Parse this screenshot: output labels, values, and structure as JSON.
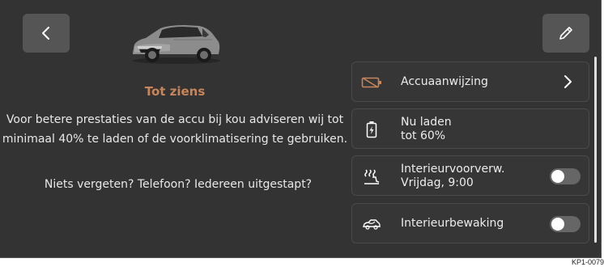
{
  "colors": {
    "screen_bg": "#333333",
    "accent": "#c7855a",
    "text": "#ececec",
    "tile_bg": "#363636",
    "button_bg": "#555555"
  },
  "header": {
    "back_icon": "chevron-left-icon",
    "edit_icon": "pencil-icon"
  },
  "message": {
    "title": "Tot ziens",
    "body": "Voor betere prestaties van de accu bij kou adviseren wij tot minimaal 40% te laden of de voorklimatisering te gebruiken.",
    "question": "Niets vergeten? Telefoon? Iedereen uitgestapt?"
  },
  "tiles": [
    {
      "label": "Accuaanwijzing",
      "icon": "battery-indicator-icon",
      "control": "chevron-right-icon"
    },
    {
      "label_line1": "Nu laden",
      "label_line2": "tot 60%",
      "icon": "charging-icon"
    },
    {
      "label_line1": "Interieurvoorverw.",
      "label_line2": "Vrijdag, 9:00",
      "icon": "interior-preheat-icon",
      "control": "toggle",
      "toggle_on": false
    },
    {
      "label": "Interieurbewaking",
      "icon": "interior-monitoring-icon",
      "control": "toggle",
      "toggle_on": false
    }
  ],
  "reference_code": "KP1-0079"
}
